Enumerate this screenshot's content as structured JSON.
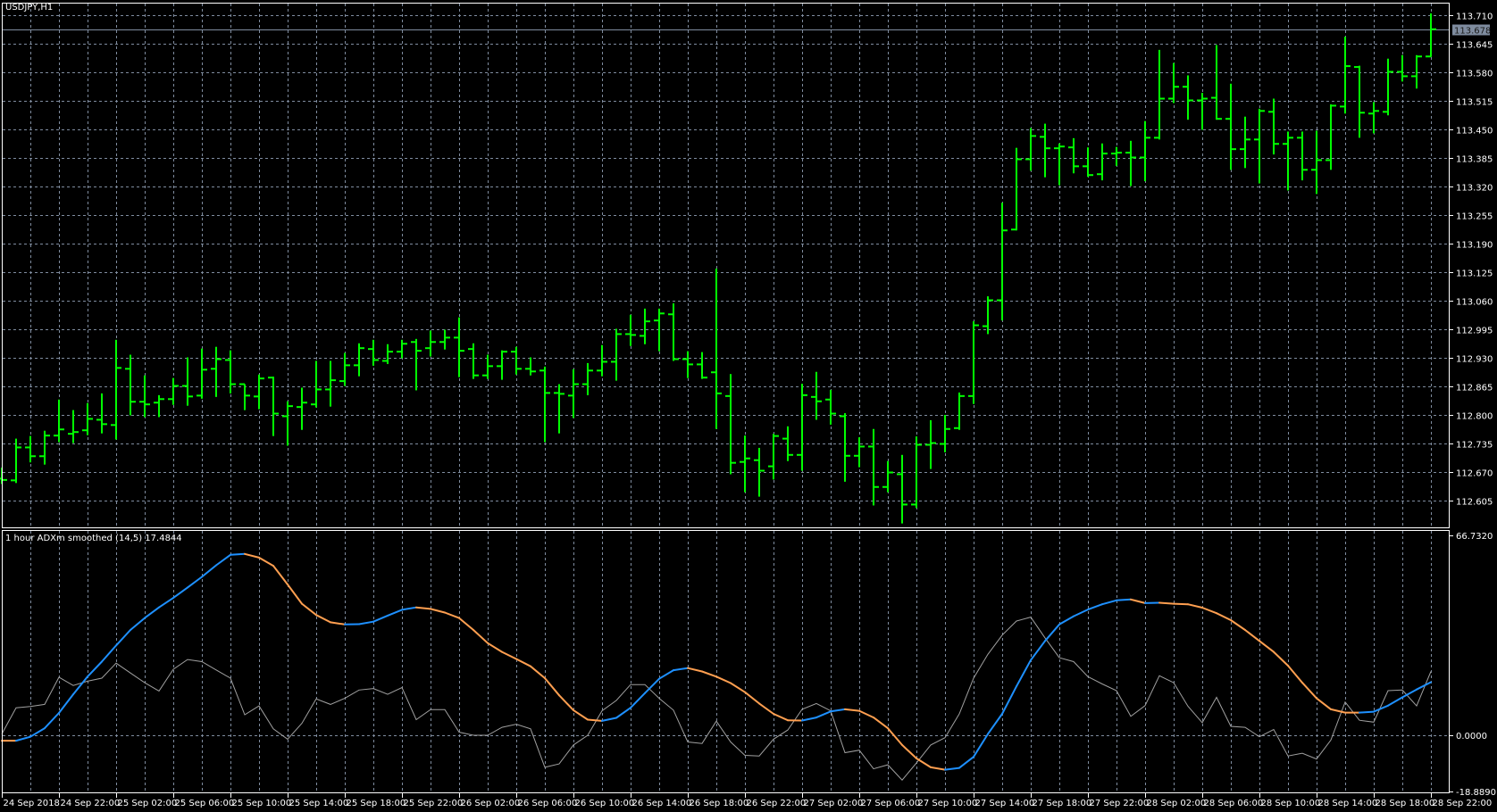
{
  "colors": {
    "background": "#000000",
    "grid": "#7f8c9f",
    "bar": "#00ff00",
    "frame": "#ffffff",
    "bid_line": "#7f8c9f",
    "bid_box": "#7f8c9f",
    "adx_up": "#1e90ff",
    "adx_down": "#ff9f50",
    "raw_line": "#a0a0a0"
  },
  "chart_data": [
    {
      "type": "ohlc",
      "title": "USDJPY,H1",
      "symbol": "USDJPY",
      "timeframe": "H1",
      "bid": "113.678",
      "bid_value": 113.678,
      "ylim": [
        112.58,
        113.72
      ],
      "y_ticks": [
        "113.710",
        "113.645",
        "113.580",
        "113.515",
        "113.450",
        "113.385",
        "113.320",
        "113.255",
        "113.190",
        "113.125",
        "113.060",
        "112.995",
        "112.930",
        "112.865",
        "112.800",
        "112.735",
        "112.670",
        "112.605"
      ],
      "bars": [
        [
          112.655,
          112.68,
          112.645,
          112.652
        ],
        [
          112.651,
          112.746,
          112.647,
          112.726
        ],
        [
          112.726,
          112.752,
          112.694,
          112.706
        ],
        [
          112.706,
          112.764,
          112.689,
          112.753
        ],
        [
          112.753,
          112.835,
          112.74,
          112.767
        ],
        [
          112.757,
          112.811,
          112.738,
          112.761
        ],
        [
          112.765,
          112.827,
          112.756,
          112.791
        ],
        [
          112.789,
          112.849,
          112.76,
          112.779
        ],
        [
          112.777,
          112.971,
          112.746,
          112.907
        ],
        [
          112.905,
          112.937,
          112.801,
          112.83
        ],
        [
          112.83,
          112.89,
          112.797,
          112.824
        ],
        [
          112.828,
          112.845,
          112.797,
          112.836
        ],
        [
          112.836,
          112.884,
          112.825,
          112.866
        ],
        [
          112.866,
          112.931,
          112.823,
          112.842
        ],
        [
          112.844,
          112.951,
          112.839,
          112.903
        ],
        [
          112.905,
          112.955,
          112.843,
          112.927
        ],
        [
          112.925,
          112.947,
          112.851,
          112.87
        ],
        [
          112.87,
          112.87,
          112.813,
          112.844
        ],
        [
          112.842,
          112.892,
          112.815,
          112.883
        ],
        [
          112.885,
          112.887,
          112.754,
          112.803
        ],
        [
          112.797,
          112.831,
          112.732,
          112.82
        ],
        [
          112.818,
          112.862,
          112.768,
          112.828
        ],
        [
          112.824,
          112.923,
          112.819,
          112.858
        ],
        [
          112.858,
          112.923,
          112.821,
          112.879
        ],
        [
          112.877,
          112.941,
          112.868,
          112.913
        ],
        [
          112.913,
          112.963,
          112.89,
          112.952
        ],
        [
          112.95,
          112.971,
          112.914,
          112.925
        ],
        [
          112.923,
          112.961,
          112.918,
          112.944
        ],
        [
          112.944,
          112.971,
          112.931,
          112.962
        ],
        [
          112.966,
          112.973,
          112.858,
          112.946
        ],
        [
          112.952,
          112.992,
          112.935,
          112.966
        ],
        [
          112.966,
          112.994,
          112.951,
          112.976
        ],
        [
          112.976,
          113.022,
          112.888,
          112.946
        ],
        [
          112.95,
          112.963,
          112.884,
          112.89
        ],
        [
          112.89,
          112.937,
          112.884,
          112.911
        ],
        [
          112.911,
          112.947,
          112.882,
          112.944
        ],
        [
          112.944,
          112.955,
          112.894,
          112.905
        ],
        [
          112.905,
          112.931,
          112.892,
          112.899
        ],
        [
          112.901,
          112.91,
          112.74,
          112.85
        ],
        [
          112.85,
          112.87,
          112.76,
          112.848
        ],
        [
          112.844,
          112.904,
          112.795,
          112.87
        ],
        [
          112.87,
          112.918,
          112.847,
          112.901
        ],
        [
          112.901,
          112.959,
          112.89,
          112.921
        ],
        [
          112.921,
          112.996,
          112.88,
          112.984
        ],
        [
          112.984,
          113.028,
          112.959,
          112.982
        ],
        [
          112.98,
          113.042,
          112.963,
          113.013
        ],
        [
          113.015,
          113.042,
          112.947,
          113.031
        ],
        [
          113.029,
          113.054,
          112.925,
          112.927
        ],
        [
          112.927,
          112.945,
          112.886,
          112.915
        ],
        [
          112.915,
          112.943,
          112.884,
          112.885
        ],
        [
          112.897,
          113.133,
          112.77,
          112.849
        ],
        [
          112.843,
          112.893,
          112.667,
          112.691
        ],
        [
          112.693,
          112.753,
          112.626,
          112.701
        ],
        [
          112.697,
          112.725,
          112.616,
          112.673
        ],
        [
          112.683,
          112.757,
          112.655,
          112.752
        ],
        [
          112.746,
          112.774,
          112.697,
          112.709
        ],
        [
          112.709,
          112.871,
          112.675,
          112.845
        ],
        [
          112.841,
          112.898,
          112.791,
          112.831
        ],
        [
          112.835,
          112.857,
          112.78,
          112.803
        ],
        [
          112.797,
          112.804,
          112.65,
          112.707
        ],
        [
          112.707,
          112.749,
          112.683,
          112.728
        ],
        [
          112.728,
          112.768,
          112.596,
          112.636
        ],
        [
          112.636,
          112.695,
          112.626,
          112.669
        ],
        [
          112.665,
          112.709,
          112.555,
          112.596
        ],
        [
          112.596,
          112.751,
          112.59,
          112.732
        ],
        [
          112.732,
          112.788,
          112.679,
          112.736
        ],
        [
          112.734,
          112.8,
          112.717,
          112.768
        ],
        [
          112.77,
          112.851,
          112.768,
          112.843
        ],
        [
          112.843,
          113.013,
          112.827,
          113.004
        ],
        [
          113.002,
          113.07,
          112.986,
          113.061
        ],
        [
          113.061,
          113.283,
          113.017,
          113.22
        ],
        [
          113.222,
          113.408,
          113.222,
          113.382
        ],
        [
          113.382,
          113.453,
          113.358,
          113.435
        ],
        [
          113.433,
          113.463,
          113.343,
          113.407
        ],
        [
          113.407,
          113.418,
          113.325,
          113.411
        ],
        [
          113.409,
          113.43,
          113.352,
          113.366
        ],
        [
          113.366,
          113.409,
          113.344,
          113.346
        ],
        [
          113.348,
          113.418,
          113.336,
          113.395
        ],
        [
          113.395,
          113.41,
          113.369,
          113.397
        ],
        [
          113.397,
          113.424,
          113.323,
          113.386
        ],
        [
          113.386,
          113.469,
          113.334,
          113.431
        ],
        [
          113.431,
          113.631,
          113.429,
          113.52
        ],
        [
          113.52,
          113.601,
          113.512,
          113.547
        ],
        [
          113.547,
          113.573,
          113.474,
          113.516
        ],
        [
          113.516,
          113.533,
          113.451,
          113.52
        ],
        [
          113.522,
          113.642,
          113.474,
          113.474
        ],
        [
          113.474,
          113.554,
          113.36,
          113.405
        ],
        [
          113.405,
          113.479,
          113.364,
          113.427
        ],
        [
          113.427,
          113.497,
          113.329,
          113.492
        ],
        [
          113.49,
          113.52,
          113.395,
          113.417
        ],
        [
          113.417,
          113.445,
          113.313,
          113.431
        ],
        [
          113.431,
          113.445,
          113.336,
          113.358
        ],
        [
          113.358,
          113.447,
          113.305,
          113.38
        ],
        [
          113.38,
          113.507,
          113.36,
          113.504
        ],
        [
          113.502,
          113.661,
          113.488,
          113.594
        ],
        [
          113.592,
          113.595,
          113.433,
          113.488
        ],
        [
          113.486,
          113.512,
          113.443,
          113.492
        ],
        [
          113.49,
          113.611,
          113.484,
          113.581
        ],
        [
          113.581,
          113.619,
          113.561,
          113.571
        ],
        [
          113.571,
          113.619,
          113.545,
          113.616
        ],
        [
          113.616,
          113.714,
          113.617,
          113.678
        ]
      ],
      "x_ticks": [
        "24 Sep 2018",
        "24 Sep 22:00",
        "25 Sep 02:00",
        "25 Sep 06:00",
        "25 Sep 10:00",
        "25 Sep 14:00",
        "25 Sep 18:00",
        "25 Sep 22:00",
        "26 Sep 02:00",
        "26 Sep 06:00",
        "26 Sep 10:00",
        "26 Sep 14:00",
        "26 Sep 18:00",
        "26 Sep 22:00",
        "27 Sep 02:00",
        "27 Sep 06:00",
        "27 Sep 10:00",
        "27 Sep 14:00",
        "27 Sep 18:00",
        "27 Sep 22:00",
        "28 Sep 02:00",
        "28 Sep 06:00",
        "28 Sep 10:00",
        "28 Sep 14:00",
        "28 Sep 18:00",
        "28 Sep 22:00"
      ],
      "x_tick_every_bars": 4,
      "grid": true
    },
    {
      "type": "line",
      "title": "1 hour ADXm smoothed (14,5) 17.4844",
      "ylim": [
        -18.889,
        66.732
      ],
      "y_ticks": [
        "66.7320",
        "0.0000",
        "-18.8890"
      ],
      "series": [
        {
          "name": "ADXm smoothed",
          "colored_by_slope": true,
          "values": [
            -1.7,
            -1.7,
            -0.4,
            2.4,
            7.4,
            13.5,
            19.3,
            24.2,
            29.5,
            34.6,
            38.5,
            42.0,
            45.1,
            48.5,
            52.0,
            55.8,
            59.2,
            59.5,
            58.3,
            55.6,
            49.5,
            43.2,
            39.5,
            37.1,
            36.4,
            36.5,
            37.3,
            39.3,
            41.2,
            42.0,
            41.5,
            40.3,
            38.5,
            34.6,
            30.3,
            27.4,
            25.1,
            22.7,
            18.8,
            13.2,
            8.3,
            5.2,
            4.8,
            5.8,
            9.1,
            13.9,
            18.6,
            21.4,
            22.1,
            21.0,
            19.3,
            17.2,
            14.2,
            10.5,
            7.1,
            5.0,
            4.9,
            5.9,
            7.9,
            8.6,
            8.1,
            5.9,
            2.4,
            -3.1,
            -7.5,
            -10.4,
            -11.2,
            -10.6,
            -7.0,
            0.5,
            7.1,
            16.1,
            24.7,
            31.0,
            36.4,
            39.1,
            41.3,
            43.0,
            44.3,
            44.6,
            43.4,
            43.5,
            43.2,
            43.0,
            41.9,
            40.1,
            37.8,
            34.6,
            31.0,
            27.4,
            22.9,
            17.3,
            12.2,
            8.6,
            7.5,
            7.5,
            7.8,
            9.8,
            12.5,
            15.1,
            17.4844
          ]
        },
        {
          "name": "ADXm raw",
          "values": [
            0.5,
            9.1,
            9.5,
            10.2,
            19.1,
            16.4,
            17.8,
            18.8,
            23.7,
            20.5,
            17.3,
            14.6,
            21.7,
            24.9,
            24.2,
            21.5,
            18.8,
            6.8,
            9.7,
            2.2,
            -1.2,
            4.0,
            12.0,
            10.2,
            12.2,
            14.9,
            15.4,
            13.5,
            15.7,
            5.2,
            8.5,
            8.5,
            1.1,
            0.1,
            0.1,
            2.7,
            3.7,
            2.2,
            -10.4,
            -9.3,
            -3.1,
            0.1,
            8.1,
            11.5,
            16.7,
            16.7,
            12.2,
            8.3,
            -2.1,
            -2.6,
            4.7,
            -2.1,
            -6.5,
            -6.7,
            -1.2,
            1.8,
            8.6,
            10.5,
            8.1,
            -5.6,
            -4.8,
            -10.9,
            -9.6,
            -14.6,
            -9.0,
            -3.1,
            -0.7,
            7.1,
            18.8,
            26.6,
            32.9,
            37.5,
            38.8,
            32.0,
            25.5,
            24.2,
            19.3,
            16.9,
            14.7,
            6.3,
            9.8,
            19.6,
            17.3,
            9.6,
            4.2,
            12.5,
            3.0,
            2.7,
            -0.4,
            2.0,
            -6.7,
            -5.8,
            -7.7,
            -1.5,
            11.0,
            5.0,
            4.4,
            14.7,
            14.9,
            9.7,
            21.0
          ]
        }
      ]
    }
  ]
}
